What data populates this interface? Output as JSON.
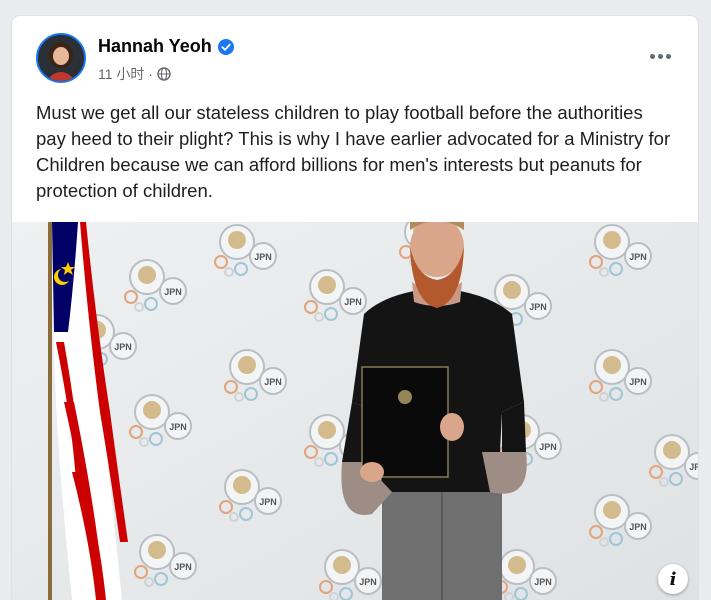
{
  "post": {
    "author": "Hannah Yeoh",
    "timestamp": "11 小时 ·",
    "audience_icon": "globe-icon",
    "verified_icon": "verified-badge-icon",
    "more_icon": "more-options-icon",
    "text": "Must we get all our stateless children to play football before the authorities pay heed to their plight? This is why I have earlier advocated for a Ministry for Children because we can afford billions for men's interests but peanuts for protection of children.",
    "photo": {
      "emblem_text": "JPN"
    },
    "info_button_label": "i"
  },
  "colors": {
    "accent": "#1877f2",
    "text_primary": "#050505",
    "text_secondary": "#65676b"
  }
}
